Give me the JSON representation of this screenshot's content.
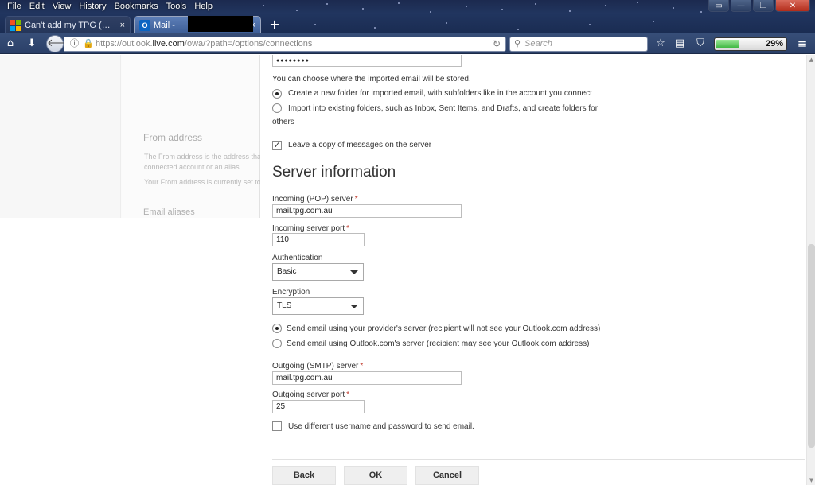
{
  "browser": {
    "menu": [
      "File",
      "Edit",
      "View",
      "History",
      "Bookmarks",
      "Tools",
      "Help"
    ],
    "tabs": [
      {
        "label": "Can't add my TPG (ISP) ema",
        "close": "×",
        "active": false
      },
      {
        "label": "Mail -",
        "close": "×",
        "active": true
      }
    ],
    "new_tab": "+",
    "url_prefix": "https://outlook.",
    "url_domain": "live.com",
    "url_path": "/owa/?path=/options/connections",
    "search_placeholder": "Search",
    "battery_percent": 29,
    "battery_label": "29%",
    "window_controls": {
      "minimize": "—",
      "maximize": "❐",
      "close": "✕"
    }
  },
  "background_panel": {
    "from_address_title": "From address",
    "from_address_desc1": "The From address is the address that",
    "from_address_desc2": "connected account or an alias.",
    "from_address_desc3": "Your From address is currently set to",
    "email_aliases": "Email aliases"
  },
  "form": {
    "password_mask": "●●●●●●●●",
    "storage_prompt": "You can choose where the imported email will be stored.",
    "storage_options": [
      {
        "label": "Create a new folder for imported email, with subfolders like in the account you connect",
        "selected": true
      },
      {
        "label": "Import into existing folders, such as Inbox, Sent Items, and Drafts, and create folders for",
        "label_cont": "others",
        "selected": false
      }
    ],
    "leave_copy": {
      "label": "Leave a copy of messages on the server",
      "checked": true
    },
    "server_heading": "Server information",
    "incoming_server_label": "Incoming (POP) server",
    "incoming_server_value": "mail.tpg.com.au",
    "incoming_port_label": "Incoming server port",
    "incoming_port_value": "110",
    "auth_label": "Authentication",
    "auth_value": "Basic",
    "encryption_label": "Encryption",
    "encryption_value": "TLS",
    "send_options": [
      {
        "label": "Send email using your provider's server (recipient will not see your Outlook.com address)",
        "selected": true
      },
      {
        "label": "Send email using Outlook.com's server (recipient may see your Outlook.com address)",
        "selected": false
      }
    ],
    "outgoing_server_label": "Outgoing (SMTP) server",
    "outgoing_server_value": "mail.tpg.com.au",
    "outgoing_port_label": "Outgoing server port",
    "outgoing_port_value": "25",
    "different_credentials": {
      "label": "Use different username and password to send email.",
      "checked": false
    },
    "required_mark": "*",
    "buttons": {
      "back": "Back",
      "ok": "OK",
      "cancel": "Cancel"
    }
  }
}
